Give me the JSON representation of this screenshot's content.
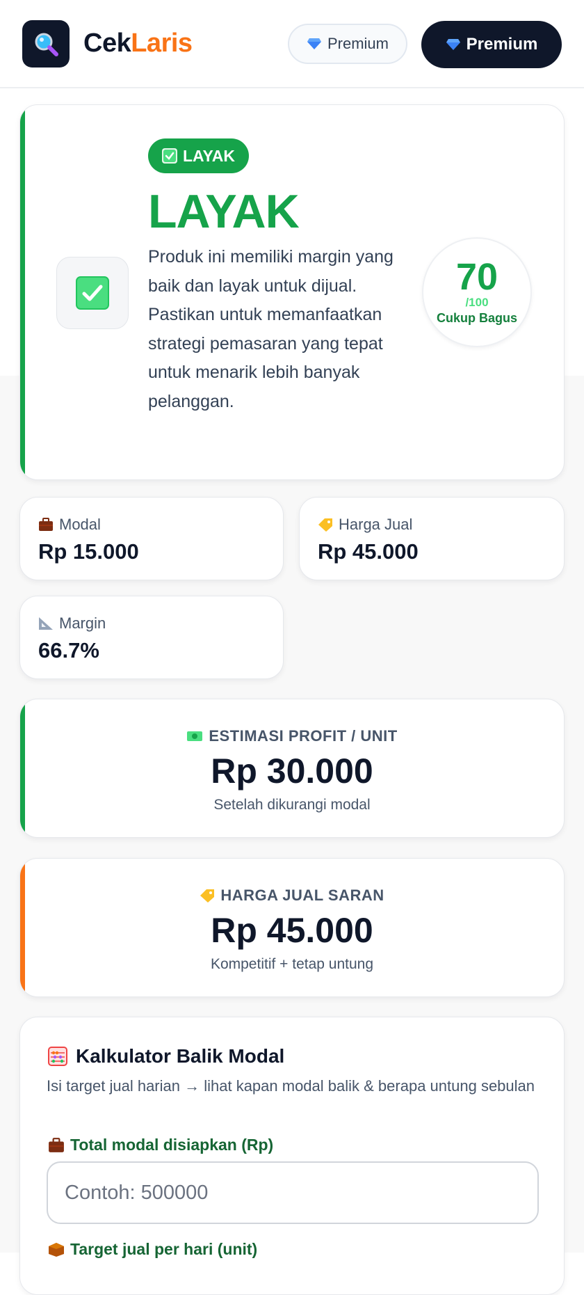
{
  "header": {
    "brand_part1": "Cek",
    "brand_part2": "Laris",
    "premium_outline_label": "Premium",
    "premium_dark_label": "Premium"
  },
  "verdict": {
    "badge": "LAYAK",
    "title": "LAYAK",
    "description": "Produk ini memiliki margin yang baik dan layak untuk dijual. Pastikan untuk memanfaatkan strategi pemasaran yang tepat untuk menarik lebih banyak pelanggan.",
    "score": "70",
    "score_max": "/100",
    "score_label": "Cukup Bagus"
  },
  "stats": {
    "modal": {
      "label": "Modal",
      "value": "Rp 15.000"
    },
    "harga_jual": {
      "label": "Harga Jual",
      "value": "Rp 45.000"
    },
    "margin": {
      "label": "Margin",
      "value": "66.7%"
    }
  },
  "profit": {
    "label": "ESTIMASI PROFIT / UNIT",
    "value": "Rp 30.000",
    "sub": "Setelah dikurangi modal"
  },
  "saran": {
    "label": "HARGA JUAL SARAN",
    "value": "Rp 45.000",
    "sub": "Kompetitif + tetap untung"
  },
  "calculator": {
    "title": "Kalkulator Balik Modal",
    "subtitle": "Isi target jual harian → lihat kapan modal balik & berapa untung sebulan",
    "field1_label": "Total modal disiapkan (Rp)",
    "field1_value": "",
    "field1_placeholder": "Contoh: 500000",
    "field2_label": "Target jual per hari (unit)"
  },
  "colors": {
    "accent_green": "#16a34a",
    "accent_orange": "#f97316",
    "dark": "#0f172a"
  },
  "icons": {
    "logo": "magnifier-icon",
    "gem": "gem-icon",
    "check": "check-icon",
    "briefcase": "briefcase-icon",
    "tag": "tag-icon",
    "ruler": "ruler-icon",
    "money": "money-icon",
    "abacus": "abacus-icon",
    "box": "box-icon"
  }
}
